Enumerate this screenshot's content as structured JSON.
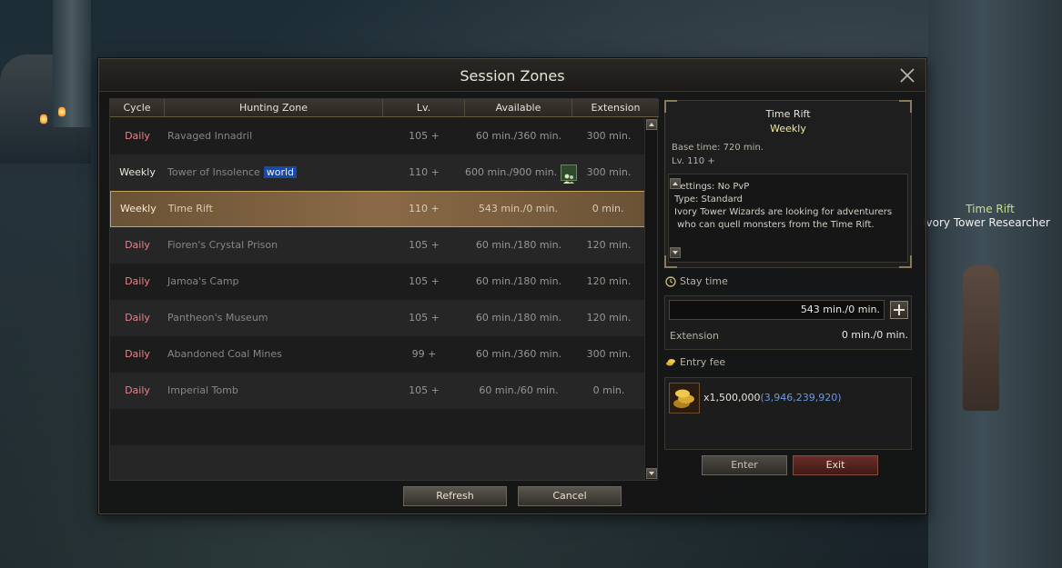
{
  "window": {
    "title": "Session Zones"
  },
  "background": {
    "npc_title": "Time Rift",
    "npc_name": "Ivory Tower Researcher"
  },
  "table": {
    "headers": {
      "cycle": "Cycle",
      "zone": "Hunting Zone",
      "lv": "Lv.",
      "available": "Available",
      "extension": "Extension"
    },
    "rows": [
      {
        "cycle": "Daily",
        "zone": "Ravaged Innadril",
        "lv": "105 +",
        "available": "60 min./360 min.",
        "extension": "300 min."
      },
      {
        "cycle": "Weekly",
        "zone": "Tower of Insolence",
        "tag": "world",
        "lv": "110 +",
        "available": "600 min./900 min.",
        "extension": "300 min.",
        "party_icon": "party-icon"
      },
      {
        "cycle": "Weekly",
        "zone": "Time Rift",
        "lv": "110 +",
        "available": "543 min./0 min.",
        "extension": "0 min.",
        "selected": true
      },
      {
        "cycle": "Daily",
        "zone": "Fioren's Crystal Prison",
        "lv": "105 +",
        "available": "60 min./180 min.",
        "extension": "120 min."
      },
      {
        "cycle": "Daily",
        "zone": "Jamoa's Camp",
        "lv": "105 +",
        "available": "60 min./180 min.",
        "extension": "120 min."
      },
      {
        "cycle": "Daily",
        "zone": "Pantheon's Museum",
        "lv": "105 +",
        "available": "60 min./180 min.",
        "extension": "120 min."
      },
      {
        "cycle": "Daily",
        "zone": "Abandoned Coal Mines",
        "lv": "99 +",
        "available": "60 min./360 min.",
        "extension": "300 min."
      },
      {
        "cycle": "Daily",
        "zone": "Imperial Tomb",
        "lv": "105 +",
        "available": "60 min./60 min.",
        "extension": "0 min."
      }
    ]
  },
  "detail": {
    "zone": "Time Rift",
    "cycle": "Weekly",
    "base_time": "Base time:  720 min.",
    "lv": "Lv.  110  +",
    "description_lines": [
      "Settings: No PvP",
      "Type: Standard",
      "Ivory Tower Wizards are looking for adventurers",
      " who can quell monsters from the Time Rift."
    ]
  },
  "stay": {
    "label": "Stay time",
    "value": "543 min./0 min.",
    "extension_label": "Extension",
    "extension_value": "0 min./0 min."
  },
  "fee": {
    "label": "Entry fee",
    "amount": "x1,500,000",
    "balance": "(3,946,239,920)"
  },
  "buttons": {
    "enter": "Enter",
    "exit": "Exit",
    "refresh": "Refresh",
    "cancel": "Cancel"
  },
  "colors": {
    "daily": "#e6848a",
    "weekly": "#ebe6dc",
    "detail_cycle": "#f0e6a0",
    "balance": "#6a9ae0",
    "npc_title": "#c8e27a",
    "selected_row": "#8a6a46"
  },
  "icons": {
    "close": "close-icon",
    "party": "party-icon",
    "scroll_up": "arrow-up-icon",
    "scroll_down": "arrow-down-icon",
    "plus": "plus-icon",
    "clock": "clock-icon",
    "coins": "coins-icon"
  }
}
